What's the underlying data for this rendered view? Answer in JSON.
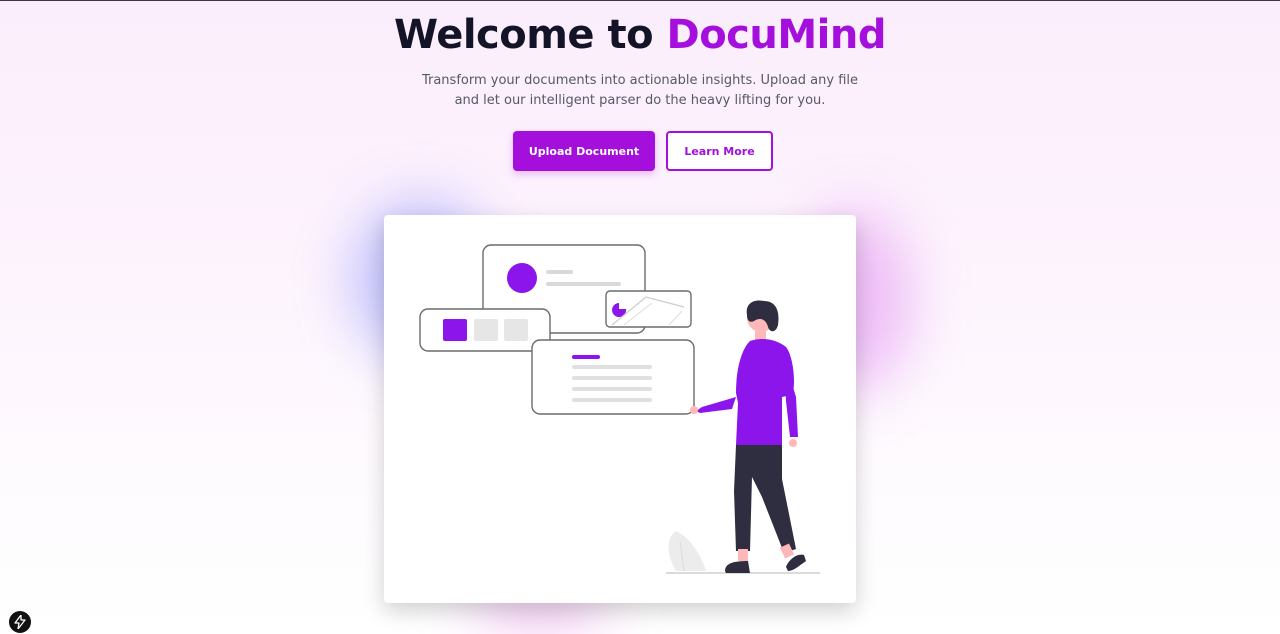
{
  "hero": {
    "title_prefix": "Welcome to ",
    "title_brand": "DocuMind",
    "subtitle_line1": "Transform your documents into actionable insights. Upload any file",
    "subtitle_line2": "and let our intelligent parser do the heavy lifting for you."
  },
  "actions": {
    "upload_label": "Upload Document",
    "learn_more_label": "Learn More"
  },
  "colors": {
    "brand": "#a40fdc",
    "title_text": "#141428",
    "subtitle_text": "#555a66",
    "figure_shirt": "#8b15ea",
    "figure_pants": "#2f2e41"
  },
  "illustration": {
    "icon": "person-with-document-cards-illustration"
  },
  "dev_badge": {
    "icon": "lightning-bolt-icon"
  }
}
